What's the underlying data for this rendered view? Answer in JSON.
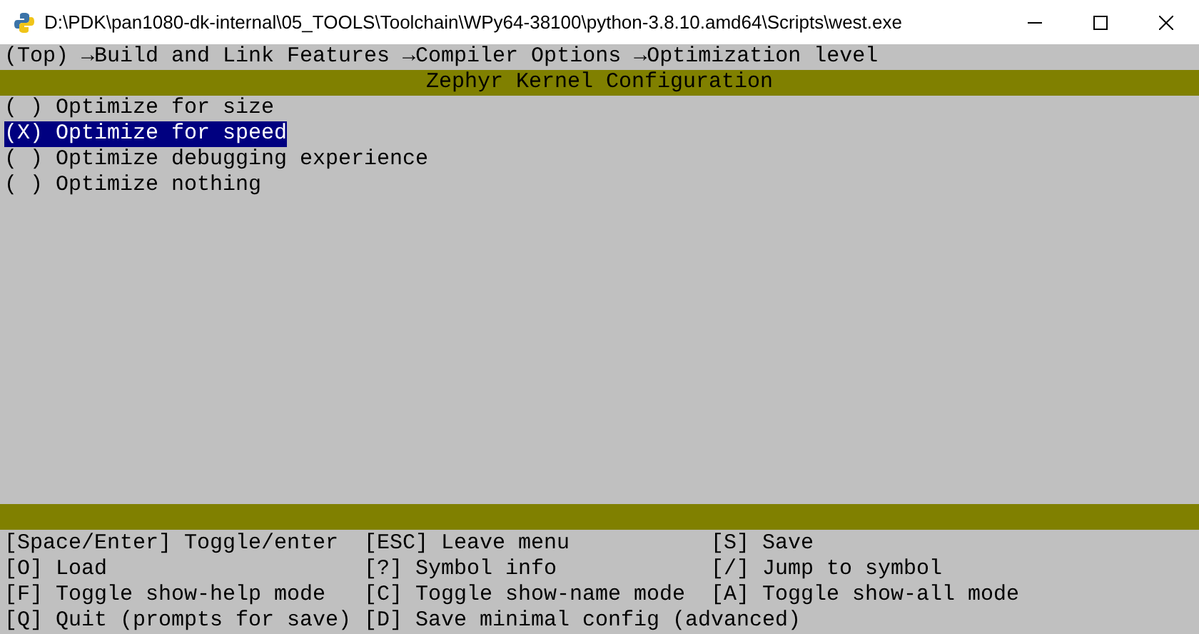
{
  "window": {
    "title": "D:\\PDK\\pan1080-dk-internal\\05_TOOLS\\Toolchain\\WPy64-38100\\python-3.8.10.amd64\\Scripts\\west.exe"
  },
  "breadcrumb": "(Top) →Build and Link Features →Compiler Options →Optimization level",
  "header": "Zephyr Kernel Configuration",
  "items": [
    {
      "marker": "( )",
      "label": "Optimize for size",
      "selected": false
    },
    {
      "marker": "(X)",
      "label": "Optimize for speed",
      "selected": true
    },
    {
      "marker": "( )",
      "label": "Optimize debugging experience",
      "selected": false
    },
    {
      "marker": "( )",
      "label": "Optimize nothing",
      "selected": false
    }
  ],
  "help": [
    [
      "[Space/Enter] Toggle/enter",
      "[ESC] Leave menu",
      "[S] Save"
    ],
    [
      "[O] Load",
      "[?] Symbol info",
      "[/] Jump to symbol"
    ],
    [
      "[F] Toggle show-help mode",
      "[C] Toggle show-name mode",
      "[A] Toggle show-all mode"
    ],
    [
      "[Q] Quit (prompts for save)",
      "[D] Save minimal config (advanced)"
    ]
  ]
}
